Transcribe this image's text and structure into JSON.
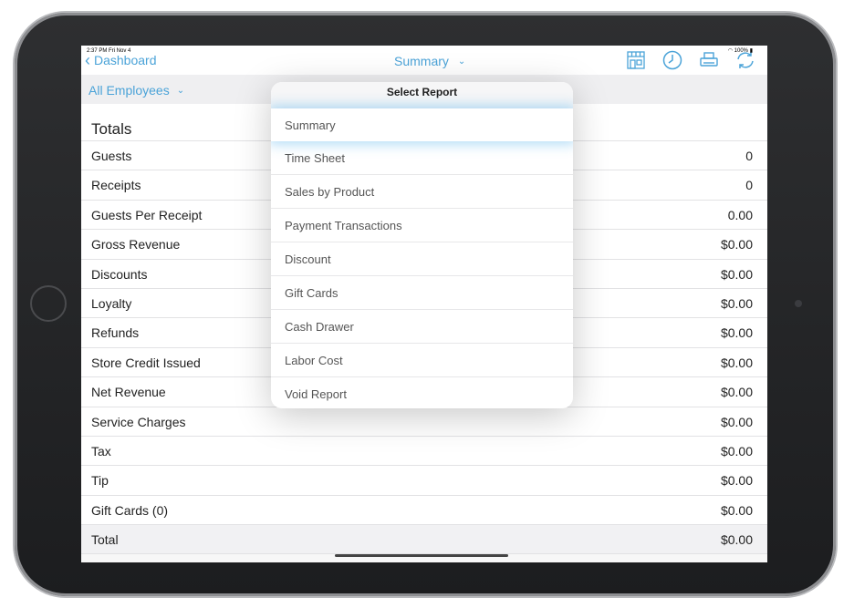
{
  "statusbar": {
    "time": "2:37 PM  Fri Nov 4",
    "battery": "100%"
  },
  "navbar": {
    "back_label": "Dashboard",
    "title": "Summary",
    "icons": [
      "store-icon",
      "clock-icon",
      "printer-icon",
      "sync-icon"
    ]
  },
  "filter": {
    "label": "All Employees"
  },
  "totals": {
    "title": "Totals",
    "rows": [
      {
        "label": "Guests",
        "value": "0"
      },
      {
        "label": "Receipts",
        "value": "0"
      },
      {
        "label": "Guests Per Receipt",
        "value": "0.00"
      },
      {
        "label": "Gross Revenue",
        "value": "$0.00"
      },
      {
        "label": "Discounts",
        "value": "$0.00"
      },
      {
        "label": "Loyalty",
        "value": "$0.00"
      },
      {
        "label": "Refunds",
        "value": "$0.00"
      },
      {
        "label": "Store Credit Issued",
        "value": "$0.00"
      },
      {
        "label": "Net Revenue",
        "value": "$0.00"
      },
      {
        "label": "Service Charges",
        "value": "$0.00"
      },
      {
        "label": "Tax",
        "value": "$0.00"
      },
      {
        "label": "Tip",
        "value": "$0.00"
      },
      {
        "label": "Gift Cards (0)",
        "value": "$0.00"
      },
      {
        "label": "Total",
        "value": "$0.00"
      }
    ]
  },
  "popover": {
    "title": "Select Report",
    "items": [
      "Summary",
      "Time Sheet",
      "Sales by Product",
      "Payment Transactions",
      "Discount",
      "Gift Cards",
      "Cash Drawer",
      "Labor Cost",
      "Void Report"
    ],
    "selected": "Summary"
  },
  "colors": {
    "accent": "#4ba3d8",
    "device": "#1e1f21",
    "row_divider": "#e2e2e4"
  }
}
